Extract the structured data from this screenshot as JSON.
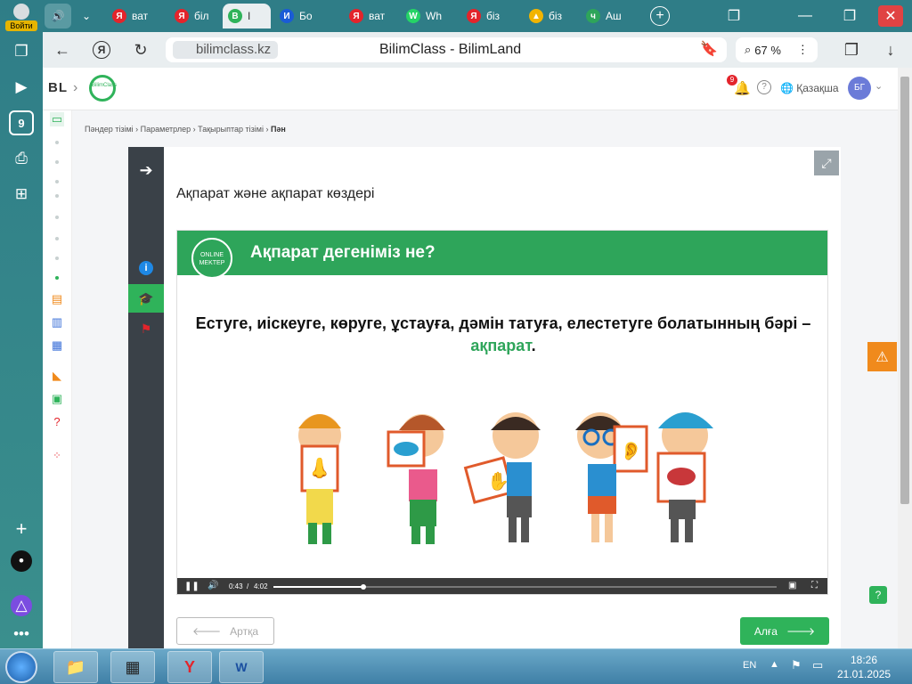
{
  "yandex_panel": {
    "login_label": "Войти"
  },
  "tabs": [
    {
      "label": "ват",
      "color": "#e3242b",
      "glyph": "Я"
    },
    {
      "label": "біл",
      "color": "#e3242b",
      "glyph": "Я"
    },
    {
      "label": "I",
      "color": "#2fb35a",
      "glyph": "B"
    },
    {
      "label": "Бо",
      "color": "#1a5bd6",
      "glyph": "И"
    },
    {
      "label": "ват",
      "color": "#e3242b",
      "glyph": "Я"
    },
    {
      "label": "Wh",
      "color": "#25d366",
      "glyph": "W"
    },
    {
      "label": "біз",
      "color": "#e3242b",
      "glyph": "Я"
    },
    {
      "label": "біз",
      "color": "#f2b400",
      "glyph": "▲"
    },
    {
      "label": "Аш",
      "color": "#2ea55a",
      "glyph": "ч"
    }
  ],
  "addressbar": {
    "domain": "bilimclass.kz",
    "title": "BilimClass - BilimLand",
    "zoom": "67 %"
  },
  "topnav": {
    "bl_logo": "BL",
    "bc_logo": "BilimClass",
    "notifications": "9",
    "language": "Қазақша",
    "avatar": "БГ"
  },
  "breadcrumb": {
    "items": [
      "Пәндер тізімі",
      "Параметрлер",
      "Тақырыптар тізімі"
    ],
    "current": "Пән"
  },
  "lesson": {
    "title": "Ақпарат және ақпарат көздері"
  },
  "video": {
    "logo": "ONLINE MEKTEP",
    "heading": "Ақпарат дегеніміз не?",
    "text_main": "Естуге, иіскеуге, көруге, ұстауға, дәмін татуға, елестетуге болатынның бәрі –",
    "text_highlight": "ақпарат",
    "text_end": ".",
    "time_current": "0:43",
    "time_separator": "/",
    "time_total": "4:02",
    "progress": 0.178
  },
  "buttons": {
    "back": "Артқа",
    "next": "Алға"
  },
  "taskbar": {
    "lang": "EN",
    "time": "18:26",
    "date": "21.01.2025"
  }
}
